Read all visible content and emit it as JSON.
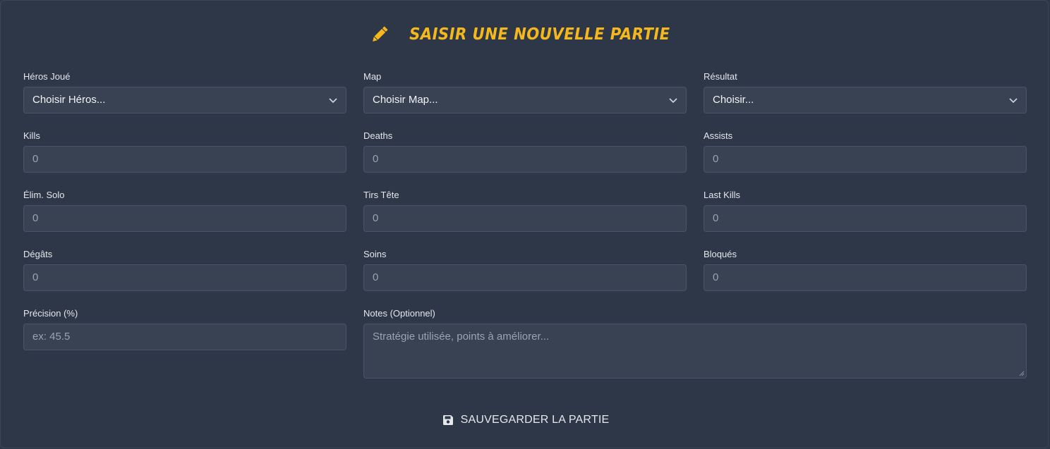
{
  "header": {
    "title": "SAISIR UNE NOUVELLE PARTIE",
    "icon": "pencil-icon",
    "accent_color": "#f5b81c"
  },
  "form": {
    "hero": {
      "label": "Héros Joué",
      "value": "Choisir Héros..."
    },
    "map": {
      "label": "Map",
      "value": "Choisir Map..."
    },
    "result": {
      "label": "Résultat",
      "value": "Choisir..."
    },
    "kills": {
      "label": "Kills",
      "placeholder": "0"
    },
    "deaths": {
      "label": "Deaths",
      "placeholder": "0"
    },
    "assists": {
      "label": "Assists",
      "placeholder": "0"
    },
    "solo_elims": {
      "label": "Élim. Solo",
      "placeholder": "0"
    },
    "headshots": {
      "label": "Tirs Tête",
      "placeholder": "0"
    },
    "last_kills": {
      "label": "Last Kills",
      "placeholder": "0"
    },
    "damage": {
      "label": "Dégâts",
      "placeholder": "0"
    },
    "healing": {
      "label": "Soins",
      "placeholder": "0"
    },
    "blocked": {
      "label": "Bloqués",
      "placeholder": "0"
    },
    "accuracy": {
      "label": "Précision (%)",
      "placeholder": "ex: 45.5"
    },
    "notes": {
      "label": "Notes (Optionnel)",
      "placeholder": "Stratégie utilisée, points à améliorer..."
    }
  },
  "actions": {
    "save_label": "SAUVEGARDER LA PARTIE",
    "save_icon": "floppy-disk-icon"
  }
}
